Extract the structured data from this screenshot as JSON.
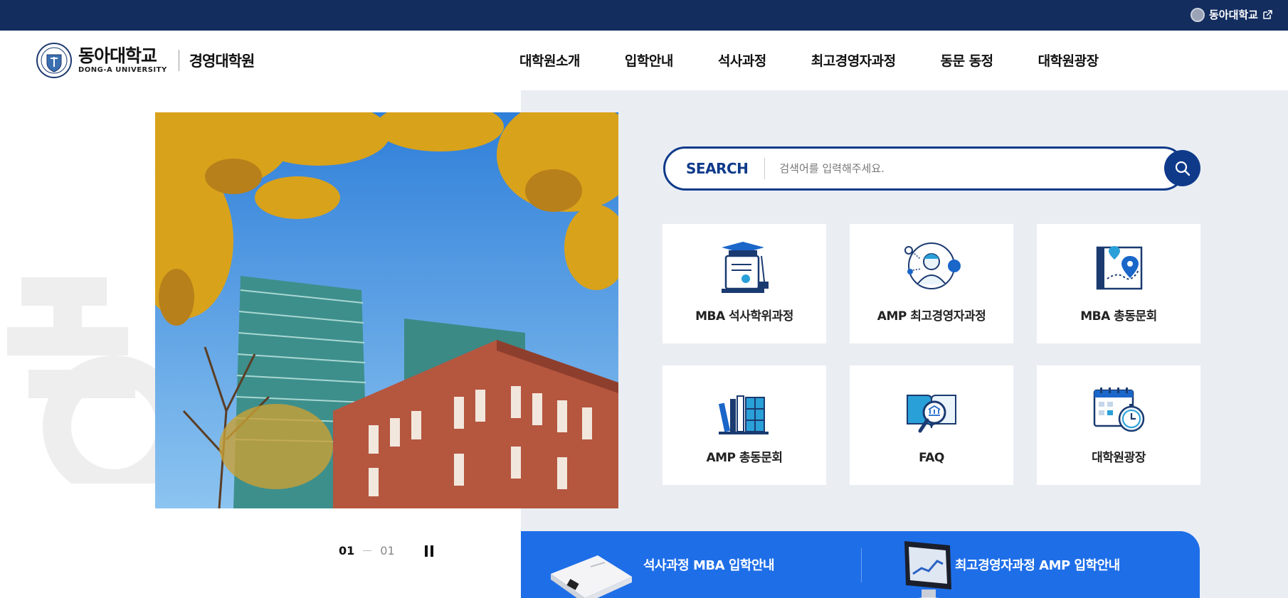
{
  "topbar": {
    "external_link_label": "동아대학교"
  },
  "header": {
    "logo_ko": "동아대학교",
    "logo_en": "DONG-A UNIVERSITY",
    "school_name": "경영대학원",
    "nav": [
      {
        "label": "대학원소개"
      },
      {
        "label": "입학안내"
      },
      {
        "label": "석사과정"
      },
      {
        "label": "최고경영자과정"
      },
      {
        "label": "동문 동정"
      },
      {
        "label": "대학원광장"
      }
    ]
  },
  "slider": {
    "current": "01",
    "total": "01"
  },
  "search": {
    "label": "SEARCH",
    "placeholder": "검색어를 입력해주세요."
  },
  "quick_menu": [
    {
      "label": "MBA 석사학위과정",
      "icon": "diploma-icon"
    },
    {
      "label": "AMP 최고경영자과정",
      "icon": "executive-icon"
    },
    {
      "label": "MBA 총동문회",
      "icon": "map-pin-icon"
    },
    {
      "label": "AMP 총동문회",
      "icon": "books-icon"
    },
    {
      "label": "FAQ",
      "icon": "magnifier-book-icon"
    },
    {
      "label": "대학원광장",
      "icon": "calendar-clock-icon"
    }
  ],
  "admission": {
    "mba_label": "석사과정 MBA 입학안내",
    "amp_label": "최고경영자과정 AMP 입학안내"
  },
  "colors": {
    "navy": "#142d5f",
    "brand_blue": "#0f3a8a",
    "banner_blue": "#1e6ee8",
    "panel_gray": "#eaeef3"
  }
}
